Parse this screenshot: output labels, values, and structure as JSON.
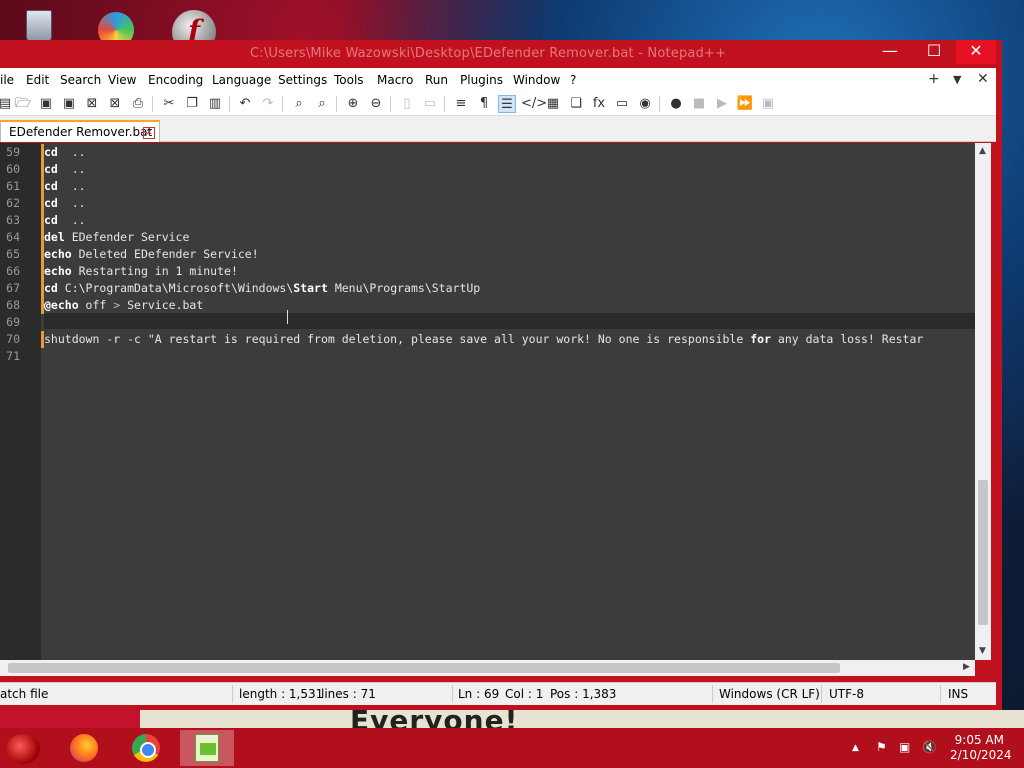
{
  "window": {
    "title": "C:\\Users\\Mike Wazowski\\Desktop\\EDefender Remover.bat - Notepad++",
    "min_symbol": "—",
    "max_symbol": "☐",
    "close_symbol": "✕"
  },
  "menu": [
    "ile",
    "Edit",
    "Search",
    "View",
    "Encoding",
    "Language",
    "Settings",
    "Tools",
    "Macro",
    "Run",
    "Plugins",
    "Window",
    "?"
  ],
  "menu_right": {
    "add": "+",
    "dropdown": "▼",
    "close": "✕"
  },
  "tab": {
    "label": "EDefender Remover.bat",
    "close": "✕"
  },
  "editor": {
    "lines": [
      {
        "num": "59",
        "parts": [
          [
            "kw",
            "cd"
          ],
          [
            "",
            "  .."
          ]
        ]
      },
      {
        "num": "60",
        "parts": [
          [
            "kw",
            "cd"
          ],
          [
            "",
            "  .."
          ]
        ]
      },
      {
        "num": "61",
        "parts": [
          [
            "kw",
            "cd"
          ],
          [
            "",
            "  .."
          ]
        ]
      },
      {
        "num": "62",
        "parts": [
          [
            "kw",
            "cd"
          ],
          [
            "",
            "  .."
          ]
        ]
      },
      {
        "num": "63",
        "parts": [
          [
            "kw",
            "cd"
          ],
          [
            "",
            "  .."
          ]
        ]
      },
      {
        "num": "64",
        "parts": [
          [
            "kw",
            "del"
          ],
          [
            "",
            " EDefender Service"
          ]
        ]
      },
      {
        "num": "65",
        "parts": [
          [
            "kw",
            "echo"
          ],
          [
            "",
            " Deleted EDefender Service!"
          ]
        ]
      },
      {
        "num": "66",
        "parts": [
          [
            "kw",
            "echo"
          ],
          [
            "",
            " Restarting in 1 minute!"
          ]
        ]
      },
      {
        "num": "67",
        "parts": [
          [
            "kw",
            "cd"
          ],
          [
            "",
            " C:\\ProgramData\\Microsoft\\Windows\\"
          ],
          [
            "kw",
            "Start"
          ],
          [
            "",
            " Menu\\Programs\\StartUp"
          ]
        ]
      },
      {
        "num": "68",
        "parts": [
          [
            "kw",
            "@echo"
          ],
          [
            "",
            " off "
          ],
          [
            "op",
            ">"
          ],
          [
            "",
            " Service.bat"
          ]
        ]
      },
      {
        "num": "69",
        "parts": []
      },
      {
        "num": "70",
        "parts": [
          [
            "",
            "shutdown -r -c \"A restart is required from deletion, please save all your work! No one is responsible "
          ],
          [
            "kw",
            "for"
          ],
          [
            "",
            " any data loss! Restar"
          ]
        ]
      },
      {
        "num": "71",
        "parts": []
      }
    ]
  },
  "status": {
    "type": "atch file",
    "length": "length : 1,531",
    "lines": "lines : 71",
    "ln": "Ln : 69",
    "col": "Col : 1",
    "pos": "Pos : 1,383",
    "eol": "Windows (CR LF)",
    "encoding": "UTF-8",
    "mode": "INS"
  },
  "taskbar": {
    "time": "9:05 AM",
    "date": "2/10/2024",
    "tray_up": "▲",
    "tray_flag": "⚑",
    "tray_network": "▣",
    "tray_volume": "🔇"
  },
  "wallpaper_text": "Everyone!"
}
